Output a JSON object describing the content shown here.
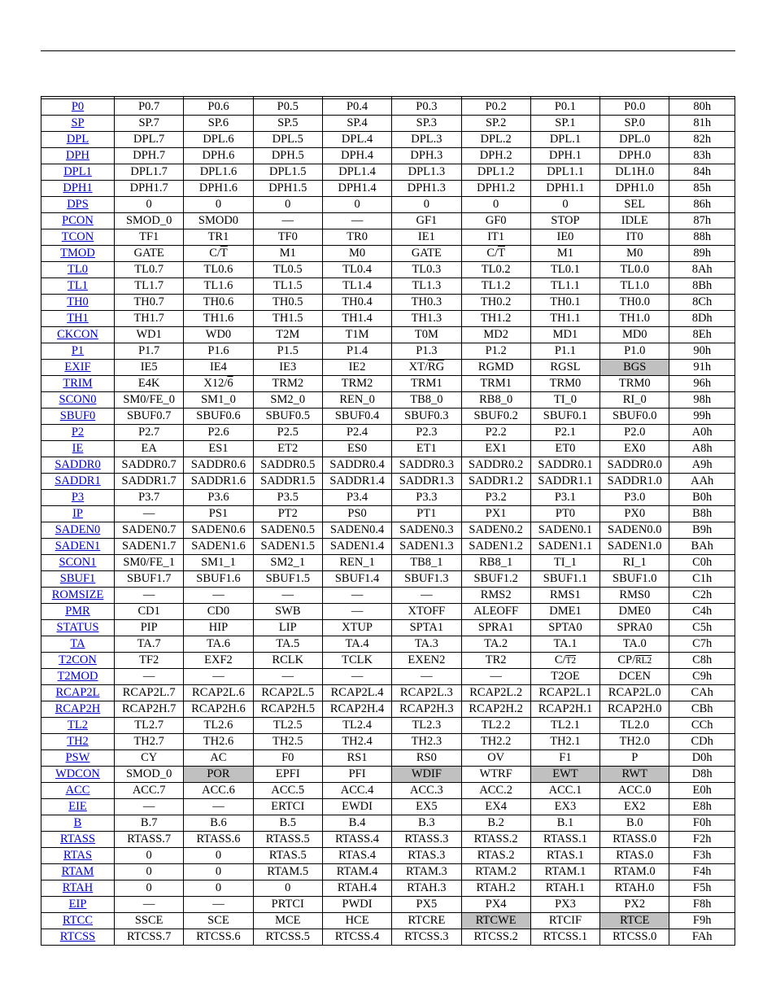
{
  "rows": [
    {
      "reg": "P0",
      "bits": [
        "P0.7",
        "P0.6",
        "P0.5",
        "P0.4",
        "P0.3",
        "P0.2",
        "P0.1",
        "P0.0"
      ],
      "addr": "80h"
    },
    {
      "reg": "SP",
      "bits": [
        "SP.7",
        "SP.6",
        "SP.5",
        "SP.4",
        "SP.3",
        "SP.2",
        "SP.1",
        "SP.0"
      ],
      "addr": "81h"
    },
    {
      "reg": "DPL",
      "bits": [
        "DPL.7",
        "DPL.6",
        "DPL.5",
        "DPL.4",
        "DPL.3",
        "DPL.2",
        "DPL.1",
        "DPL.0"
      ],
      "addr": "82h"
    },
    {
      "reg": "DPH",
      "bits": [
        "DPH.7",
        "DPH.6",
        "DPH.5",
        "DPH.4",
        "DPH.3",
        "DPH.2",
        "DPH.1",
        "DPH.0"
      ],
      "addr": "83h"
    },
    {
      "reg": "DPL1",
      "bits": [
        "DPL1.7",
        "DPL1.6",
        "DPL1.5",
        "DPL1.4",
        "DPL1.3",
        "DPL1.2",
        "DPL1.1",
        "DL1H.0"
      ],
      "addr": "84h"
    },
    {
      "reg": "DPH1",
      "bits": [
        "DPH1.7",
        "DPH1.6",
        "DPH1.5",
        "DPH1.4",
        "DPH1.3",
        "DPH1.2",
        "DPH1.1",
        "DPH1.0"
      ],
      "addr": "85h"
    },
    {
      "reg": "DPS",
      "bits": [
        "0",
        "0",
        "0",
        "0",
        "0",
        "0",
        "0",
        "SEL"
      ],
      "addr": "86h"
    },
    {
      "reg": "PCON",
      "bits": [
        "SMOD_0",
        "SMOD0",
        "—",
        "—",
        "GF1",
        "GF0",
        "STOP",
        "IDLE"
      ],
      "addr": "87h"
    },
    {
      "reg": "TCON",
      "bits": [
        "TF1",
        "TR1",
        "TF0",
        "TR0",
        "IE1",
        "IT1",
        "IE0",
        "IT0"
      ],
      "addr": "88h"
    },
    {
      "reg": "TMOD",
      "bits": [
        "GATE",
        {
          "html": "C/<span class='ov'>T</span>"
        },
        "M1",
        "M0",
        "GATE",
        {
          "html": "C/<span class='ov'>T</span>"
        },
        "M1",
        "M0"
      ],
      "addr": "89h"
    },
    {
      "reg": "TL0",
      "bits": [
        "TL0.7",
        "TL0.6",
        "TL0.5",
        "TL0.4",
        "TL0.3",
        "TL0.2",
        "TL0.1",
        "TL0.0"
      ],
      "addr": "8Ah"
    },
    {
      "reg": "TL1",
      "bits": [
        "TL1.7",
        "TL1.6",
        "TL1.5",
        "TL1.4",
        "TL1.3",
        "TL1.2",
        "TL1.1",
        "TL1.0"
      ],
      "addr": "8Bh"
    },
    {
      "reg": "TH0",
      "bits": [
        "TH0.7",
        "TH0.6",
        "TH0.5",
        "TH0.4",
        "TH0.3",
        "TH0.2",
        "TH0.1",
        "TH0.0"
      ],
      "addr": "8Ch"
    },
    {
      "reg": "TH1",
      "bits": [
        "TH1.7",
        "TH1.6",
        "TH1.5",
        "TH1.4",
        "TH1.3",
        "TH1.2",
        "TH1.1",
        "TH1.0"
      ],
      "addr": "8Dh"
    },
    {
      "reg": "CKCON",
      "bits": [
        "WD1",
        "WD0",
        "T2M",
        "T1M",
        "T0M",
        "MD2",
        "MD1",
        "MD0"
      ],
      "addr": "8Eh"
    },
    {
      "reg": "P1",
      "bits": [
        "P1.7",
        "P1.6",
        "P1.5",
        "P1.4",
        "P1.3",
        "P1.2",
        "P1.1",
        "P1.0"
      ],
      "addr": "90h"
    },
    {
      "reg": "EXIF",
      "bits": [
        "IE5",
        "IE4",
        "IE3",
        "IE2",
        {
          "html": "XT/<span class='ov'>RG</span>"
        },
        "RGMD",
        "RGSL",
        {
          "text": "BGS",
          "shade": true
        }
      ],
      "addr": "91h"
    },
    {
      "reg": "TRIM",
      "bits": [
        "E4K",
        {
          "html": "X12/<span class='ov'>6</span>"
        },
        "TRM2",
        "TRM2",
        "TRM1",
        "TRM1",
        "TRM0",
        "TRM0"
      ],
      "addr": "96h"
    },
    {
      "reg": "SCON0",
      "bits": [
        "SM0/FE_0",
        "SM1_0",
        "SM2_0",
        "REN_0",
        "TB8_0",
        "RB8_0",
        "TI_0",
        "RI_0"
      ],
      "addr": "98h"
    },
    {
      "reg": "SBUF0",
      "bits": [
        "SBUF0.7",
        "SBUF0.6",
        "SBUF0.5",
        "SBUF0.4",
        "SBUF0.3",
        "SBUF0.2",
        "SBUF0.1",
        "SBUF0.0"
      ],
      "addr": "99h"
    },
    {
      "reg": "P2",
      "bits": [
        "P2.7",
        "P2.6",
        "P2.5",
        "P2.4",
        "P2.3",
        "P2.2",
        "P2.1",
        "P2.0"
      ],
      "addr": "A0h"
    },
    {
      "reg": "IE",
      "bits": [
        "EA",
        "ES1",
        "ET2",
        "ES0",
        "ET1",
        "EX1",
        "ET0",
        "EX0"
      ],
      "addr": "A8h"
    },
    {
      "reg": "SADDR0",
      "bits": [
        "SADDR0.7",
        "SADDR0.6",
        "SADDR0.5",
        "SADDR0.4",
        "SADDR0.3",
        "SADDR0.2",
        "SADDR0.1",
        "SADDR0.0"
      ],
      "addr": "A9h"
    },
    {
      "reg": "SADDR1",
      "bits": [
        "SADDR1.7",
        "SADDR1.6",
        "SADDR1.5",
        "SADDR1.4",
        "SADDR1.3",
        "SADDR1.2",
        "SADDR1.1",
        "SADDR1.0"
      ],
      "addr": "AAh"
    },
    {
      "reg": "P3",
      "bits": [
        "P3.7",
        "P3.6",
        "P3.5",
        "P3.4",
        "P3.3",
        "P3.2",
        "P3.1",
        "P3.0"
      ],
      "addr": "B0h"
    },
    {
      "reg": "IP",
      "bits": [
        "—",
        "PS1",
        "PT2",
        "PS0",
        "PT1",
        "PX1",
        "PT0",
        "PX0"
      ],
      "addr": "B8h"
    },
    {
      "reg": "SADEN0",
      "bits": [
        "SADEN0.7",
        "SADEN0.6",
        "SADEN0.5",
        "SADEN0.4",
        "SADEN0.3",
        "SADEN0.2",
        "SADEN0.1",
        "SADEN0.0"
      ],
      "addr": "B9h"
    },
    {
      "reg": "SADEN1",
      "bits": [
        "SADEN1.7",
        "SADEN1.6",
        "SADEN1.5",
        "SADEN1.4",
        "SADEN1.3",
        "SADEN1.2",
        "SADEN1.1",
        "SADEN1.0"
      ],
      "addr": "BAh"
    },
    {
      "reg": "SCON1",
      "bits": [
        "SM0/FE_1",
        "SM1_1",
        "SM2_1",
        "REN_1",
        "TB8_1",
        "RB8_1",
        "TI_1",
        "RI_1"
      ],
      "addr": "C0h"
    },
    {
      "reg": "SBUF1",
      "bits": [
        "SBUF1.7",
        "SBUF1.6",
        "SBUF1.5",
        "SBUF1.4",
        "SBUF1.3",
        "SBUF1.2",
        "SBUF1.1",
        "SBUF1.0"
      ],
      "addr": "C1h"
    },
    {
      "reg": "ROMSIZE",
      "bits": [
        "—",
        "—",
        "—",
        "—",
        "—",
        "RMS2",
        "RMS1",
        "RMS0"
      ],
      "addr": "C2h"
    },
    {
      "reg": "PMR",
      "bits": [
        "CD1",
        "CD0",
        "SWB",
        "—",
        "XTOFF",
        "ALEOFF",
        "DME1",
        "DME0"
      ],
      "addr": "C4h"
    },
    {
      "reg": "STATUS",
      "bits": [
        "PIP",
        "HIP",
        "LIP",
        "XTUP",
        "SPTA1",
        "SPRA1",
        "SPTA0",
        "SPRA0"
      ],
      "addr": "C5h"
    },
    {
      "reg": "TA",
      "bits": [
        "TA.7",
        "TA.6",
        "TA.5",
        "TA.4",
        "TA.3",
        "TA.2",
        "TA.1",
        "TA.0"
      ],
      "addr": "C7h"
    },
    {
      "reg": "T2CON",
      "bits": [
        "TF2",
        "EXF2",
        "RCLK",
        "TCLK",
        "EXEN2",
        "TR2",
        {
          "html": "C/<span class='sml ov'>T2</span>"
        },
        {
          "html": "CP/<span class='sml ov'>RL2</span>"
        }
      ],
      "addr": "C8h"
    },
    {
      "reg": "T2MOD",
      "bits": [
        "—",
        "—",
        "—",
        "—",
        "—",
        "—",
        "T2OE",
        "DCEN"
      ],
      "addr": "C9h"
    },
    {
      "reg": "RCAP2L",
      "bits": [
        "RCAP2L.7",
        "RCAP2L.6",
        "RCAP2L.5",
        "RCAP2L.4",
        "RCAP2L.3",
        "RCAP2L.2",
        "RCAP2L.1",
        "RCAP2L.0"
      ],
      "addr": "CAh"
    },
    {
      "reg": "RCAP2H",
      "bits": [
        "RCAP2H.7",
        "RCAP2H.6",
        "RCAP2H.5",
        "RCAP2H.4",
        "RCAP2H.3",
        "RCAP2H.2",
        "RCAP2H.1",
        "RCAP2H.0"
      ],
      "addr": "CBh"
    },
    {
      "reg": "TL2",
      "bits": [
        "TL2.7",
        "TL2.6",
        "TL2.5",
        "TL2.4",
        "TL2.3",
        "TL2.2",
        "TL2.1",
        "TL2.0"
      ],
      "addr": "CCh"
    },
    {
      "reg": "TH2",
      "bits": [
        "TH2.7",
        "TH2.6",
        "TH2.5",
        "TH2.4",
        "TH2.3",
        "TH2.2",
        "TH2.1",
        "TH2.0"
      ],
      "addr": "CDh"
    },
    {
      "reg": "PSW",
      "bits": [
        "CY",
        "AC",
        "F0",
        "RS1",
        "RS0",
        "OV",
        "F1",
        "P"
      ],
      "addr": "D0h"
    },
    {
      "reg": "WDCON",
      "bits": [
        "SMOD_0",
        {
          "text": "POR",
          "shade": true
        },
        "EPFI",
        "PFI",
        {
          "text": "WDIF",
          "shade": true
        },
        "WTRF",
        {
          "text": "EWT",
          "shade": true
        },
        {
          "text": "RWT",
          "shade": true
        }
      ],
      "addr": "D8h"
    },
    {
      "reg": "ACC",
      "bits": [
        "ACC.7",
        "ACC.6",
        "ACC.5",
        "ACC.4",
        "ACC.3",
        "ACC.2",
        "ACC.1",
        "ACC.0"
      ],
      "addr": "E0h"
    },
    {
      "reg": "EIE",
      "bits": [
        "—",
        "—",
        "ERTCI",
        "EWDI",
        "EX5",
        "EX4",
        "EX3",
        "EX2"
      ],
      "addr": "E8h"
    },
    {
      "reg": "B",
      "bits": [
        "B.7",
        "B.6",
        "B.5",
        "B.4",
        "B.3",
        "B.2",
        "B.1",
        "B.0"
      ],
      "addr": "F0h"
    },
    {
      "reg": "RTASS",
      "bits": [
        "RTASS.7",
        "RTASS.6",
        "RTASS.5",
        "RTASS.4",
        "RTASS.3",
        "RTASS.2",
        "RTASS.1",
        "RTASS.0"
      ],
      "addr": "F2h"
    },
    {
      "reg": "RTAS",
      "bits": [
        "0",
        "0",
        "RTAS.5",
        "RTAS.4",
        "RTAS.3",
        "RTAS.2",
        "RTAS.1",
        "RTAS.0"
      ],
      "addr": "F3h"
    },
    {
      "reg": "RTAM",
      "bits": [
        "0",
        "0",
        "RTAM.5",
        "RTAM.4",
        "RTAM.3",
        "RTAM.2",
        "RTAM.1",
        "RTAM.0"
      ],
      "addr": "F4h"
    },
    {
      "reg": "RTAH",
      "bits": [
        "0",
        "0",
        "0",
        "RTAH.4",
        "RTAH.3",
        "RTAH.2",
        "RTAH.1",
        "RTAH.0"
      ],
      "addr": "F5h"
    },
    {
      "reg": "EIP",
      "bits": [
        "—",
        "—",
        "PRTCI",
        "PWDI",
        "PX5",
        "PX4",
        "PX3",
        "PX2"
      ],
      "addr": "F8h"
    },
    {
      "reg": "RTCC",
      "bits": [
        "SSCE",
        "SCE",
        "MCE",
        "HCE",
        "RTCRE",
        {
          "text": "RTCWE",
          "shade": true
        },
        "RTCIF",
        {
          "text": "RTCE",
          "shade": true
        }
      ],
      "addr": "F9h"
    },
    {
      "reg": "RTCSS",
      "bits": [
        "RTCSS.7",
        "RTCSS.6",
        "RTCSS.5",
        "RTCSS.4",
        "RTCSS.3",
        "RTCSS.2",
        "RTCSS.1",
        "RTCSS.0"
      ],
      "addr": "FAh"
    }
  ]
}
